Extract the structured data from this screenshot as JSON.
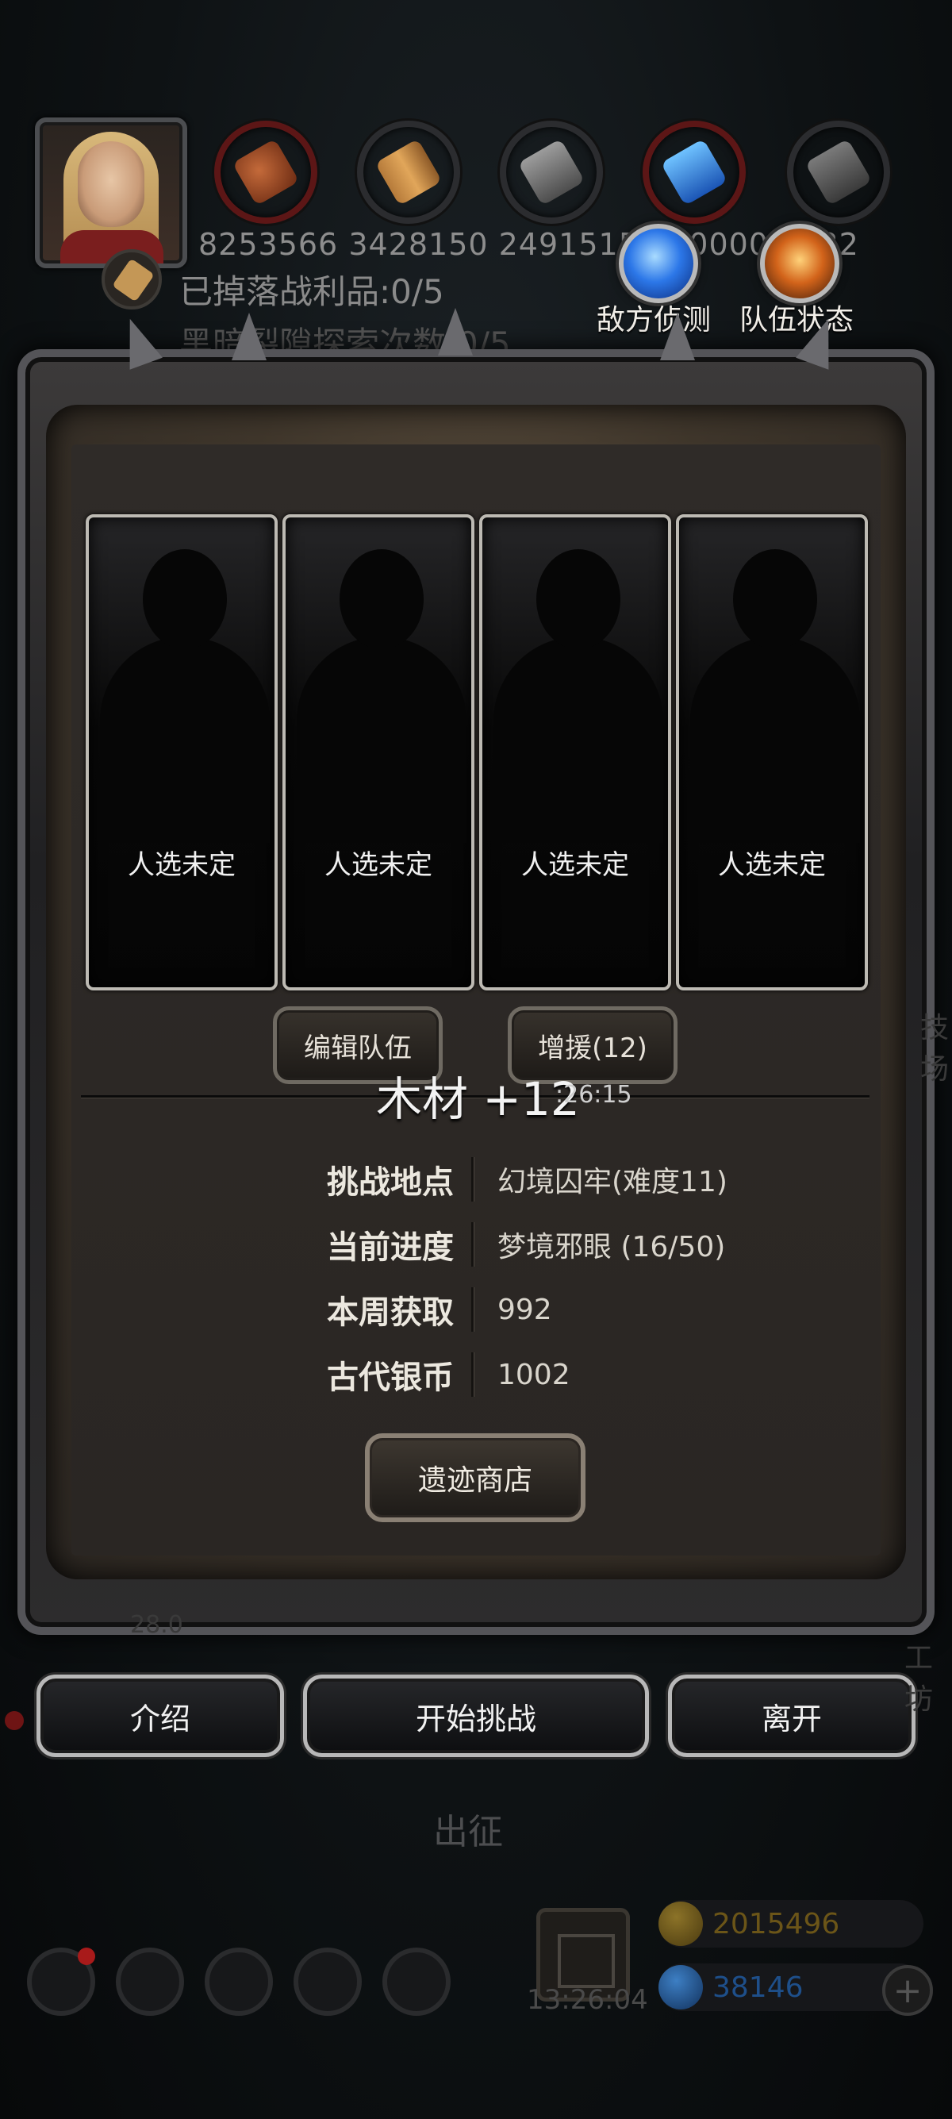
{
  "header": {
    "resources": [
      {
        "icon": "meat-icon",
        "value": "8253566"
      },
      {
        "icon": "wood-icon",
        "value": "3428150"
      },
      {
        "icon": "iron-icon",
        "value": "2491515"
      },
      {
        "icon": "crystal-icon",
        "value": "0000"
      },
      {
        "icon": "stone-icon",
        "value": "1732"
      }
    ],
    "resource_values_text": "8253566  3428150  2491515  000000  1732",
    "loot_status": "已掉落战利品:0/5",
    "rift_status": "黑暗裂隙探索次数:0/5",
    "scout_label": "敌方侦测",
    "team_status_label": "队伍状态"
  },
  "team_slots": [
    {
      "label": "人选未定"
    },
    {
      "label": "人选未定"
    },
    {
      "label": "人选未定"
    },
    {
      "label": "人选未定"
    }
  ],
  "buttons": {
    "edit_team": "编辑队伍",
    "reinforce": "增援(12)",
    "relic_shop": "遗迹商店",
    "intro": "介绍",
    "start_challenge": "开始挑战",
    "leave": "离开"
  },
  "float": {
    "reward": "木材 +12",
    "time": ":26:15"
  },
  "info": [
    {
      "key": "挑战地点",
      "value": "幻境囚牢(难度11)"
    },
    {
      "key": "当前进度",
      "value": "梦境邪眼 (16/50)"
    },
    {
      "key": "本周获取",
      "value": "992"
    },
    {
      "key": "古代银币",
      "value": "1002"
    }
  ],
  "background": {
    "march_label": "出征",
    "gift_timer": "13:26:04",
    "gold_amount": "2015496",
    "gem_amount": "38146",
    "edge_left": "28.0",
    "edge_right_top": "技场",
    "edge_right_bottom": "工坊"
  },
  "colors": {
    "gold_text": "#6b5518",
    "gem_text": "#1e4f8a",
    "panel_bg": "#2c2824"
  }
}
